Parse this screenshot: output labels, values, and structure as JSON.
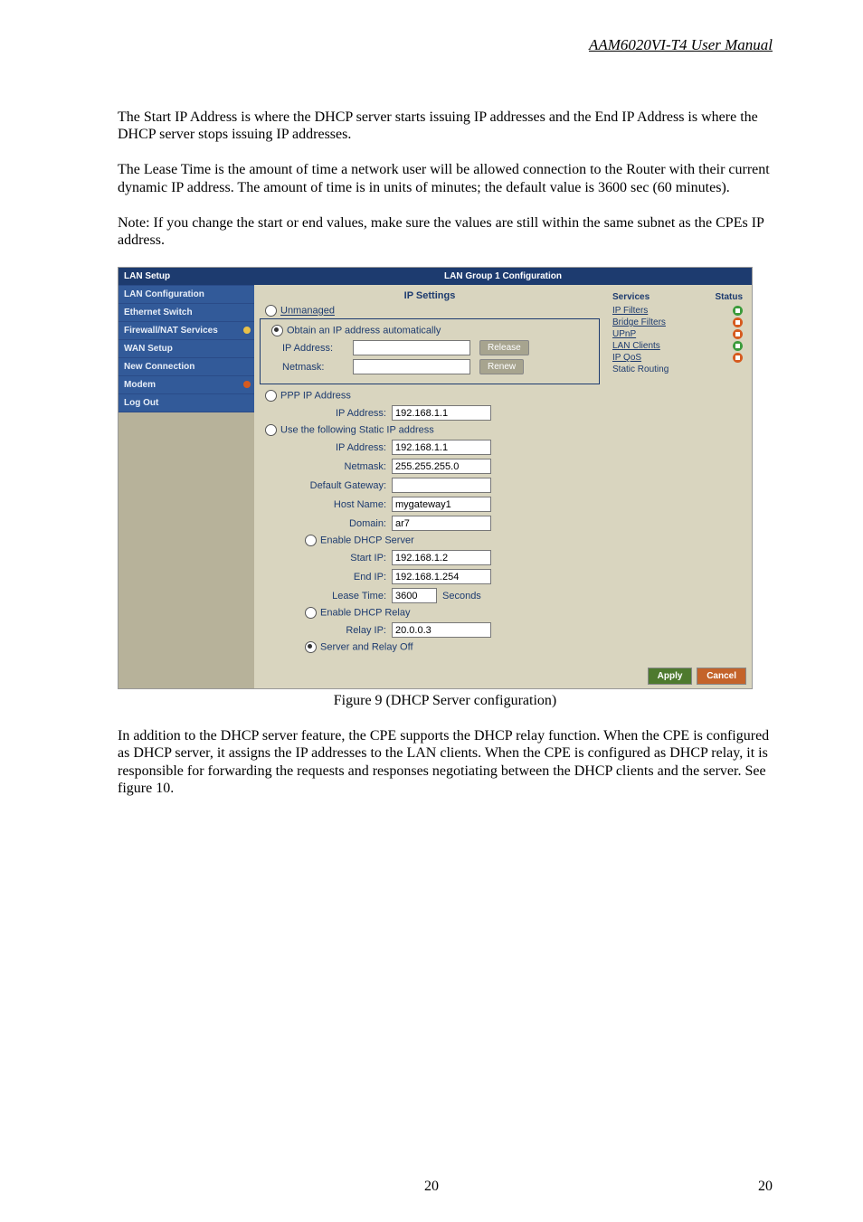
{
  "doc": {
    "header": "AAM6020VI-T4 User Manual",
    "para1": "The Start IP Address is where the DHCP server starts issuing IP addresses and the End IP Address is where the DHCP server stops issuing IP addresses.",
    "para2": "The Lease Time is the amount of time a network user will be allowed connection to the Router with their current dynamic IP address. The amount of time is in units of minutes; the default value is 3600 sec (60 minutes).",
    "para3": "Note: If you change the start or end values, make sure the values are still within the same subnet as the CPEs IP address.",
    "caption": "Figure 9 (DHCP Server configuration)",
    "para4": "In addition to the DHCP server feature, the CPE supports the DHCP relay function. When the CPE is configured as DHCP server, it assigns the IP addresses to the LAN clients. When the CPE is configured as DHCP relay, it is responsible for forwarding the requests and responses negotiating between the DHCP clients and the server. See figure 10.",
    "pagenum": "20"
  },
  "ui": {
    "sidebar_head": "LAN Setup",
    "sidebar": [
      "LAN Configuration",
      "Ethernet Switch",
      "Firewall/NAT Services",
      "WAN Setup",
      "New Connection",
      "Modem",
      "Log Out"
    ],
    "main_title": "LAN Group 1 Configuration",
    "ip_settings": "IP Settings",
    "unmanaged": "Unmanaged",
    "obtain_auto": "Obtain an IP address automatically",
    "ip_address_lbl": "IP Address:",
    "netmask_lbl": "Netmask:",
    "release_btn": "Release",
    "renew_btn": "Renew",
    "ppp_opt": "PPP IP Address",
    "ppp_ip_lbl": "IP Address:",
    "ppp_ip_val": "192.168.1.1",
    "static_opt": "Use the following Static IP address",
    "static_ip_lbl": "IP Address:",
    "static_ip_val": "192.168.1.1",
    "static_nm_lbl": "Netmask:",
    "static_nm_val": "255.255.255.0",
    "gateway_lbl": "Default Gateway:",
    "host_lbl": "Host Name:",
    "host_val": "mygateway1",
    "domain_lbl": "Domain:",
    "domain_val": "ar7",
    "dhcp_server_opt": "Enable DHCP Server",
    "start_ip_lbl": "Start IP:",
    "start_ip_val": "192.168.1.2",
    "end_ip_lbl": "End IP:",
    "end_ip_val": "192.168.1.254",
    "lease_lbl": "Lease Time:",
    "lease_val": "3600",
    "seconds": "Seconds",
    "dhcp_relay_opt": "Enable DHCP Relay",
    "relay_ip_lbl": "Relay IP:",
    "relay_ip_val": "20.0.0.3",
    "server_off_opt": "Server and Relay Off",
    "services_h": "Services",
    "status_h": "Status",
    "services": [
      "IP Filters",
      "Bridge Filters",
      "UPnP",
      "LAN Clients",
      "IP QoS",
      "Static Routing"
    ],
    "apply": "Apply",
    "cancel": "Cancel"
  }
}
